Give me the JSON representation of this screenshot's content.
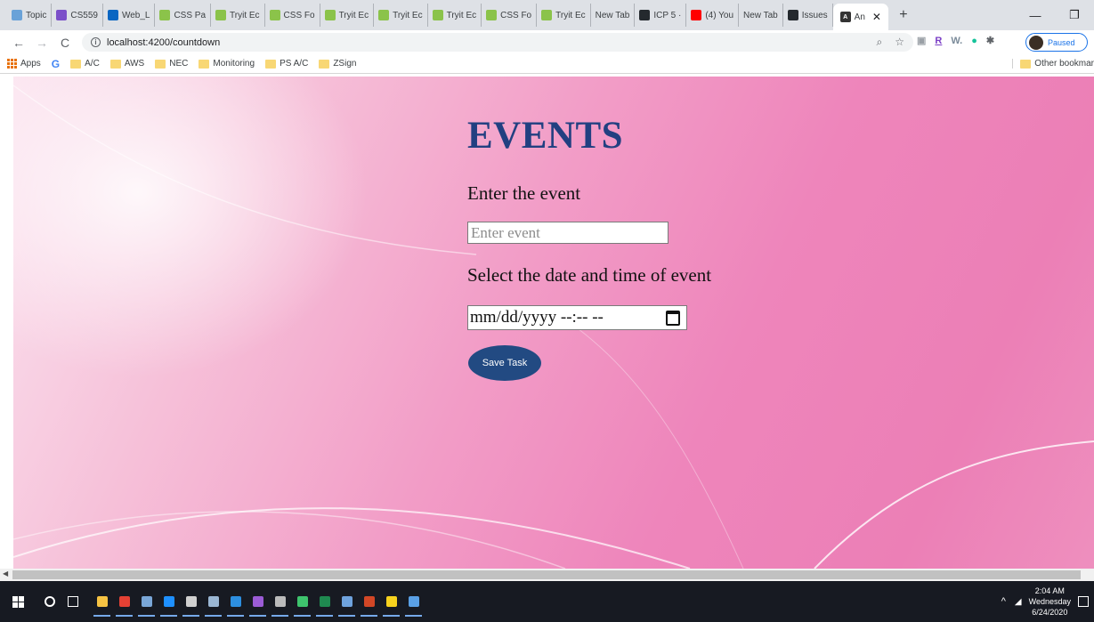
{
  "browser": {
    "tabs": [
      {
        "label": "Topic",
        "fav_color": "#6aa2d8"
      },
      {
        "label": "CS559",
        "fav_color": "#7b4fc9"
      },
      {
        "label": "Web_L",
        "fav_color": "#0a66c2"
      },
      {
        "label": "CSS Pa",
        "fav_color": "#8bc34a"
      },
      {
        "label": "Tryit Ec",
        "fav_color": "#8bc34a"
      },
      {
        "label": "CSS Fo",
        "fav_color": "#8bc34a"
      },
      {
        "label": "Tryit Ec",
        "fav_color": "#8bc34a"
      },
      {
        "label": "Tryit Ec",
        "fav_color": "#8bc34a"
      },
      {
        "label": "Tryit Ec",
        "fav_color": "#8bc34a"
      },
      {
        "label": "CSS Fo",
        "fav_color": "#8bc34a"
      },
      {
        "label": "Tryit Ec",
        "fav_color": "#8bc34a"
      },
      {
        "label": "New Tab",
        "fav_color": ""
      },
      {
        "label": "ICP 5 ·",
        "fav_color": "#24292e"
      },
      {
        "label": "(4) You",
        "fav_color": "#ff0000"
      },
      {
        "label": "New Tab",
        "fav_color": ""
      },
      {
        "label": "Issues",
        "fav_color": "#24292e"
      }
    ],
    "active_tab": {
      "label": "An",
      "fav_color": "#333333"
    },
    "url": "localhost:4200/countdown",
    "profile_status": "Paused",
    "bookmarks": [
      {
        "label": "Apps",
        "icon": "apps-icon"
      },
      {
        "label": "",
        "icon": "google-icon"
      },
      {
        "label": "A/C",
        "icon": "folder-icon"
      },
      {
        "label": "AWS",
        "icon": "folder-icon"
      },
      {
        "label": "NEC",
        "icon": "folder-icon"
      },
      {
        "label": "Monitoring",
        "icon": "folder-icon"
      },
      {
        "label": "PS A/C",
        "icon": "folder-icon"
      },
      {
        "label": "ZSign",
        "icon": "folder-icon"
      }
    ],
    "other_bookmarks": "Other bookmar"
  },
  "page": {
    "heading": "EVENTS",
    "event_label": "Enter the event",
    "event_placeholder": "Enter event",
    "date_label": "Select the date and time of event",
    "date_value": "mm/dd/yyyy --:-- --",
    "save_button": "Save Task",
    "colors": {
      "heading": "#224081",
      "button": "#224a82"
    }
  },
  "taskbar": {
    "apps": [
      {
        "name": "file-explorer-icon",
        "color": "#f6c343"
      },
      {
        "name": "chrome-icon",
        "color": "#e44134"
      },
      {
        "name": "app-icon",
        "color": "#7aa7d8"
      },
      {
        "name": "edge-icon",
        "color": "#1e90ff"
      },
      {
        "name": "settings-icon",
        "color": "#d0d0d0"
      },
      {
        "name": "camera-icon",
        "color": "#9bb7d4"
      },
      {
        "name": "vscode-icon",
        "color": "#2d8fe0"
      },
      {
        "name": "app-icon",
        "color": "#9b5cd6"
      },
      {
        "name": "terminal-icon",
        "color": "#bbbbbb"
      },
      {
        "name": "app-icon",
        "color": "#3ec46d"
      },
      {
        "name": "excel-icon",
        "color": "#1f8a50"
      },
      {
        "name": "app-icon",
        "color": "#6fa3de"
      },
      {
        "name": "powerpoint-icon",
        "color": "#d24726"
      },
      {
        "name": "sticky-notes-icon",
        "color": "#f7d21e"
      },
      {
        "name": "app-icon",
        "color": "#5aa0e6"
      }
    ],
    "time": "2:04 AM",
    "day": "Wednesday",
    "date": "6/24/2020"
  }
}
